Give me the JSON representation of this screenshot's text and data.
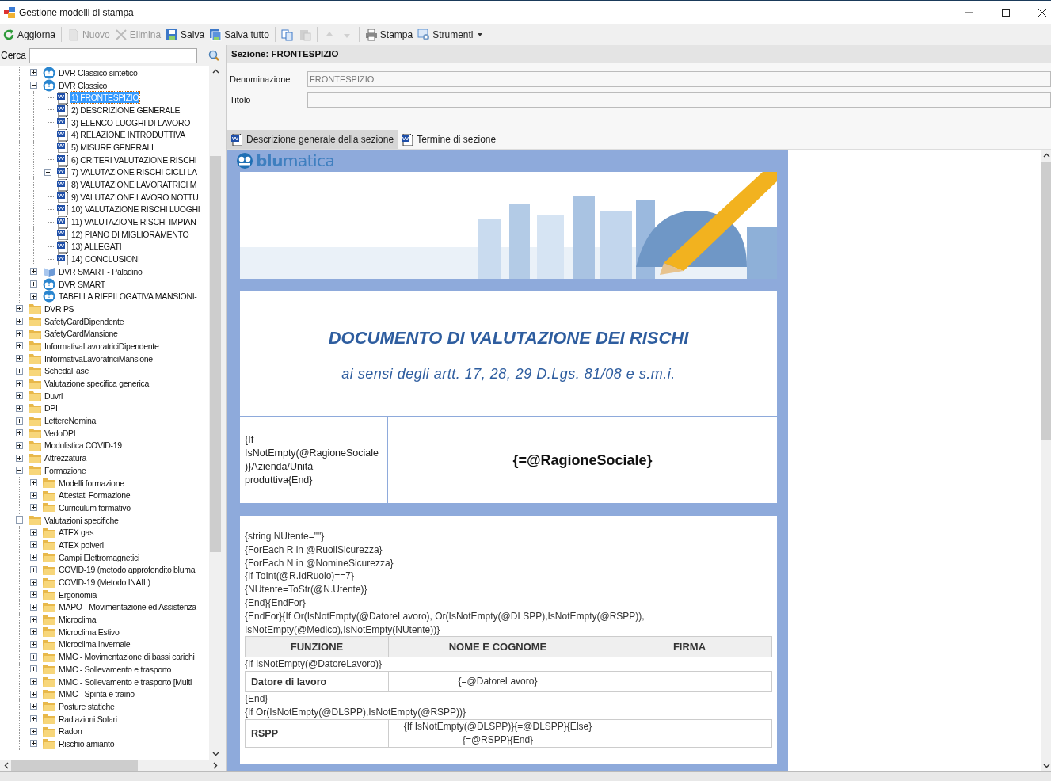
{
  "window": {
    "title": "Gestione modelli di stampa"
  },
  "toolbar": [
    {
      "kind": "button",
      "label": "Aggiorna",
      "disabled": false
    },
    {
      "kind": "separator"
    },
    {
      "kind": "button",
      "label": "Nuovo",
      "disabled": true
    },
    {
      "kind": "button",
      "label": "Elimina",
      "disabled": true
    },
    {
      "kind": "button",
      "label": "Salva",
      "disabled": false
    },
    {
      "kind": "button",
      "label": "Salva tutto",
      "disabled": false
    },
    {
      "kind": "separator"
    },
    {
      "kind": "button",
      "disabled": false
    },
    {
      "kind": "button",
      "disabled": true
    },
    {
      "kind": "separator"
    },
    {
      "kind": "button",
      "disabled": true
    },
    {
      "kind": "button",
      "disabled": true
    },
    {
      "kind": "separator"
    },
    {
      "kind": "button",
      "label": "Stampa",
      "disabled": false
    },
    {
      "kind": "menu",
      "label": "Strumenti",
      "disabled": false
    }
  ],
  "search": {
    "label": "Cerca"
  },
  "tree": {
    "items": [
      {
        "children": [
          {
            "label": "DVR Classico sintetico",
            "kind": "template",
            "expanded": false,
            "selected": false
          },
          {
            "label": "DVR Classico",
            "kind": "template",
            "expanded": true,
            "selected": false,
            "children": [
              {
                "label": "1) FRONTESPIZIO",
                "kind": "document",
                "selected": true
              },
              {
                "label": "2) DESCRIZIONE GENERALE",
                "kind": "document",
                "selected": false
              },
              {
                "label": "3) ELENCO LUOGHI DI LAVORO",
                "kind": "document",
                "selected": false
              },
              {
                "label": "4) RELAZIONE INTRODUTTIVA",
                "kind": "document",
                "selected": false
              },
              {
                "label": "5) MISURE GENERALI",
                "kind": "document",
                "selected": false
              },
              {
                "label": "6) CRITERI VALUTAZIONE RISCHI",
                "kind": "document",
                "selected": false
              },
              {
                "label": "7) VALUTAZIONE RISCHI CICLI LA",
                "kind": "document",
                "expanded": false,
                "selected": false
              },
              {
                "label": "8) VALUTAZIONE LAVORATRICI M",
                "kind": "document",
                "selected": false
              },
              {
                "label": "9) VALUTAZIONE LAVORO NOTTU",
                "kind": "document",
                "selected": false
              },
              {
                "label": "10) VALUTAZIONE RISCHI LUOGHI",
                "kind": "document",
                "selected": false
              },
              {
                "label": "11) VALUTAZIONE RISCHI IMPIAN",
                "kind": "document",
                "selected": false
              },
              {
                "label": "12) PIANO DI MIGLIORAMENTO",
                "kind": "document",
                "selected": false
              },
              {
                "label": "13) ALLEGATI",
                "kind": "document",
                "selected": false
              },
              {
                "label": "14) CONCLUSIONI",
                "kind": "document",
                "selected": false
              }
            ]
          },
          {
            "label": "DVR SMART - Paladino",
            "kind": "book",
            "expanded": false,
            "selected": false
          },
          {
            "label": "DVR SMART",
            "kind": "template",
            "expanded": false,
            "selected": false
          },
          {
            "label": "TABELLA RIEPILOGATIVA MANSIONI-",
            "kind": "template",
            "expanded": false,
            "selected": false
          }
        ]
      },
      {
        "label": "DVR PS",
        "kind": "folder",
        "expanded": false,
        "selected": false
      },
      {
        "label": "SafetyCardDipendente",
        "kind": "folder",
        "expanded": false,
        "selected": false
      },
      {
        "label": "SafetyCardMansione",
        "kind": "folder",
        "expanded": false,
        "selected": false
      },
      {
        "label": "InformativaLavoratriciDipendente",
        "kind": "folder",
        "expanded": false,
        "selected": false
      },
      {
        "label": "InformativaLavoratriciMansione",
        "kind": "folder",
        "expanded": false,
        "selected": false
      },
      {
        "label": "SchedaFase",
        "kind": "folder",
        "expanded": false,
        "selected": false
      },
      {
        "label": "Valutazione specifica generica",
        "kind": "folder",
        "expanded": false,
        "selected": false
      },
      {
        "label": "Duvri",
        "kind": "folder",
        "expanded": false,
        "selected": false
      },
      {
        "label": "DPI",
        "kind": "folder",
        "expanded": false,
        "selected": false
      },
      {
        "label": "LettereNomina",
        "kind": "folder",
        "expanded": false,
        "selected": false
      },
      {
        "label": "VedoDPI",
        "kind": "folder",
        "expanded": false,
        "selected": false
      },
      {
        "label": "Modulistica COVID-19",
        "kind": "folder",
        "expanded": false,
        "selected": false
      },
      {
        "label": "Attrezzatura",
        "kind": "folder",
        "expanded": false,
        "selected": false
      },
      {
        "label": "Formazione",
        "kind": "folder",
        "expanded": true,
        "selected": false,
        "children": [
          {
            "label": "Modelli formazione",
            "kind": "folder",
            "expanded": false,
            "selected": false
          },
          {
            "label": "Attestati Formazione",
            "kind": "folder",
            "expanded": false,
            "selected": false
          },
          {
            "label": "Curriculum formativo",
            "kind": "folder",
            "expanded": false,
            "selected": false
          }
        ]
      },
      {
        "label": "Valutazioni specifiche",
        "kind": "folder",
        "expanded": true,
        "selected": false,
        "children": [
          {
            "label": "ATEX gas",
            "kind": "folder",
            "expanded": false,
            "selected": false
          },
          {
            "label": "ATEX polveri",
            "kind": "folder",
            "expanded": false,
            "selected": false
          },
          {
            "label": "Campi Elettromagnetici",
            "kind": "folder",
            "expanded": false,
            "selected": false
          },
          {
            "label": "COVID-19 (metodo approfondito bluma",
            "kind": "folder",
            "expanded": false,
            "selected": false
          },
          {
            "label": "COVID-19 (Metodo INAIL)",
            "kind": "folder",
            "expanded": false,
            "selected": false
          },
          {
            "label": "Ergonomia",
            "kind": "folder",
            "expanded": false,
            "selected": false
          },
          {
            "label": "MAPO - Movimentazione ed Assistenza",
            "kind": "folder",
            "expanded": false,
            "selected": false
          },
          {
            "label": "Microclima",
            "kind": "folder",
            "expanded": false,
            "selected": false
          },
          {
            "label": "Microclima Estivo",
            "kind": "folder",
            "expanded": false,
            "selected": false
          },
          {
            "label": "Microclima Invernale",
            "kind": "folder",
            "expanded": false,
            "selected": false
          },
          {
            "label": "MMC - Movimentazione di bassi carichi",
            "kind": "folder",
            "expanded": false,
            "selected": false
          },
          {
            "label": "MMC - Sollevamento e trasporto",
            "kind": "folder",
            "expanded": false,
            "selected": false
          },
          {
            "label": "MMC - Sollevamento e trasporto [Multi",
            "kind": "folder",
            "expanded": false,
            "selected": false
          },
          {
            "label": "MMC - Spinta e traino",
            "kind": "folder",
            "expanded": false,
            "selected": false
          },
          {
            "label": "Posture statiche",
            "kind": "folder",
            "expanded": false,
            "selected": false
          },
          {
            "label": "Radiazioni Solari",
            "kind": "folder",
            "expanded": false,
            "selected": false
          },
          {
            "label": "Radon",
            "kind": "folder",
            "expanded": false,
            "selected": false
          },
          {
            "label": "Rischio amianto",
            "kind": "folder",
            "expanded": false,
            "selected": false
          }
        ]
      }
    ]
  },
  "section": {
    "title": "Sezione: FRONTESPIZIO",
    "fields": [
      {
        "label": "Denominazione",
        "value": "FRONTESPIZIO"
      },
      {
        "label": "Titolo"
      }
    ],
    "tabs": [
      {
        "label": "Descrizione generale della sezione",
        "selected": true
      },
      {
        "label": "Termine di sezione",
        "selected": false
      }
    ]
  },
  "document": {
    "logo": "**blu**matica",
    "heading": "DOCUMENTO DI VALUTAZIONE DEI RISCHI",
    "subheading": "ai sensi degli artt. 17, 28, 29 D.Lgs. 81/08 e s.m.i.",
    "company": {
      "label": "{If IsNotEmpty(@RagioneSociale)}Azienda/Unità produttiva{End}",
      "value": "{=@RagioneSociale}"
    },
    "content": [
      {
        "kind": "line",
        "text": "{string NUtente=\"\"}"
      },
      {
        "kind": "line",
        "text": "{ForEach R in @RuoliSicurezza}"
      },
      {
        "kind": "line",
        "text": "{ForEach N in @NomineSicurezza}"
      },
      {
        "kind": "line",
        "text": "{If ToInt(@R.IdRuolo)==7}"
      },
      {
        "kind": "line",
        "text": "{NUtente=ToStr(@N.Utente)}"
      },
      {
        "kind": "line",
        "text": "{End}{EndFor}"
      },
      {
        "kind": "line",
        "text": "{EndFor}{If Or(IsNotEmpty(@DatoreLavoro), Or(IsNotEmpty(@DLSPP),IsNotEmpty(@RSPP)), IsNotEmpty(@Medico),IsNotEmpty(NUtente))}"
      },
      {
        "kind": "header",
        "cells": [
          "FUNZIONE",
          "NOME E COGNOME",
          "FIRMA"
        ]
      },
      {
        "kind": "line",
        "text": "{If IsNotEmpty(@DatoreLavoro)}"
      },
      {
        "kind": "row",
        "cells": [
          "Datore di lavoro",
          "{=@DatoreLavoro}"
        ]
      },
      {
        "kind": "line",
        "text": "{End}"
      },
      {
        "kind": "line",
        "text": "{If Or(IsNotEmpty(@DLSPP),IsNotEmpty(@RSPP))}"
      },
      {
        "kind": "row",
        "cells": [
          "RSPP",
          "{If IsNotEmpty(@DLSPP)}{=@DLSPP}{Else}{=@RSPP}{End}"
        ]
      }
    ]
  }
}
